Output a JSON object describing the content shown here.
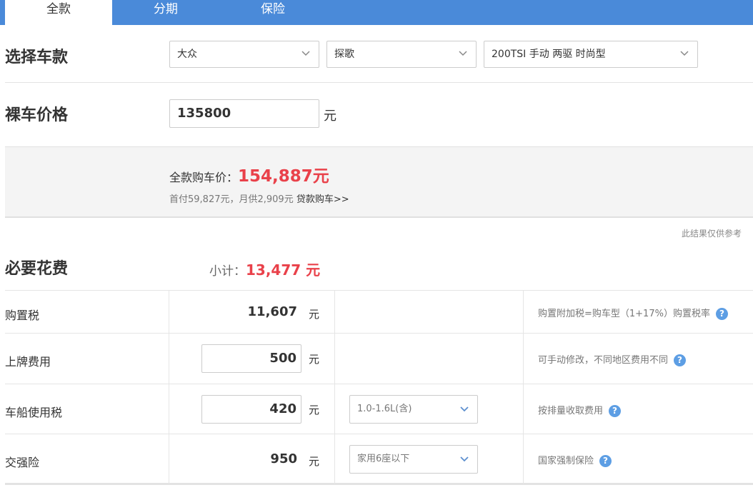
{
  "tabs": [
    {
      "label": "全款",
      "active": true
    },
    {
      "label": "分期",
      "active": false
    },
    {
      "label": "保险",
      "active": false
    }
  ],
  "select_model": {
    "heading": "选择车款",
    "brand": "大众",
    "series": "探歌",
    "trim": "200TSI 手动 两驱 时尚型"
  },
  "bare_price": {
    "heading": "裸车价格",
    "value": "135800",
    "unit": "元"
  },
  "summary": {
    "total_label": "全款购车价：",
    "total_value": "154,887元",
    "sub_text": "首付59,827元，月供2,909元",
    "loan_link": "贷款购车>>"
  },
  "disclaimer": "此结果仅供参考",
  "necessary": {
    "heading": "必要花费",
    "subtotal_label": "小计：",
    "subtotal_value": "13,477 元",
    "rows": [
      {
        "label": "购置税",
        "value": "11,607",
        "unit": "元",
        "note": "购置附加税=购车型（1+17%）购置税率"
      },
      {
        "label": "上牌费用",
        "value": "500",
        "unit": "元",
        "note": "可手动修改，不同地区费用不同"
      },
      {
        "label": "车船使用税",
        "value": "420",
        "unit": "元",
        "option": "1.0-1.6L(含)",
        "note": "按排量收取费用"
      },
      {
        "label": "交强险",
        "value": "950",
        "unit": "元",
        "option": "家用6座以下",
        "note": "国家强制保险"
      }
    ]
  },
  "colors": {
    "tab_bar": "#4a8ad9",
    "highlight": "#e9414a",
    "help_icon": "#5d9ee4"
  }
}
